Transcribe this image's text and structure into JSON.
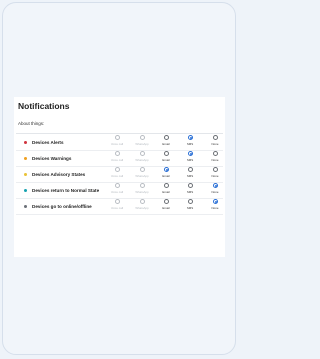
{
  "panel": {
    "title": "Notifications",
    "subtitle": "About things:"
  },
  "columns": [
    "Voice call",
    "WhatsApp",
    "Email",
    "SMS",
    "None"
  ],
  "rows": [
    {
      "label": "Devices Alerts",
      "dot_color": "#d0343f",
      "selected": "SMS"
    },
    {
      "label": "Devices Warnings",
      "dot_color": "#f0a020",
      "selected": "SMS"
    },
    {
      "label": "Devices Advisory States",
      "dot_color": "#e9c236",
      "selected": "Email"
    },
    {
      "label": "Devices return to Normal State",
      "dot_color": "#16a2b0",
      "selected": "None"
    },
    {
      "label": "Devices go to online/offline",
      "dot_color": "#6b7078",
      "selected": "None"
    }
  ],
  "disabled_columns": [
    "Voice call",
    "WhatsApp"
  ],
  "colors": {
    "accent": "#2a6fd6",
    "background": "#eef3f9",
    "card": "#ffffff"
  }
}
